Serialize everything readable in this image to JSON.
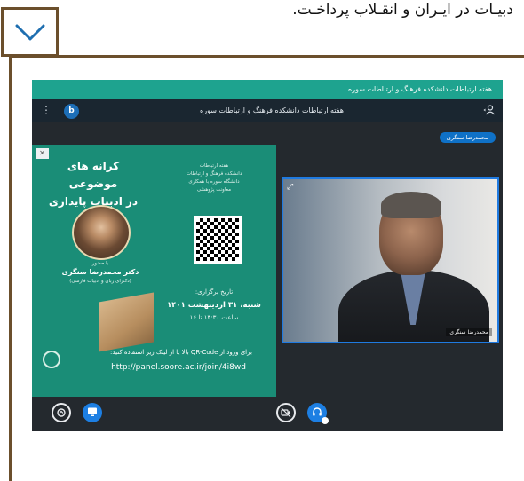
{
  "page": {
    "top_text": "دبیـات در ایـران و انقـلاب پرداخـت."
  },
  "conference": {
    "titlebar": "هفته ارتباطات دانشکده فرهنگ و ارتباطات سوره",
    "room_title": "هفته ارتباطات دانشکده فرهنگ و ارتباطات سوره",
    "app_logo": "b",
    "presenter_badge": "محمدرضا سنگری",
    "video_name": "محمدرضا سنگری"
  },
  "slide": {
    "title": "کرانه های موضوعی\nدر ادبیات پایداری",
    "guest_pre": "با حضور",
    "guest_name": "دکتر محمدرضا سنگری",
    "guest_title": "(دکترای زبان و ادبیات فارسی)",
    "org": "هفته ارتباطات\nدانشکده فرهنگ و ارتباطات\nدانشگاه سوره با همکاری\nمعاونت پژوهشی",
    "date_label": "تاریخ برگزاری:",
    "date_value": "شنبه، ۳۱ اردیبهشت ۱۴۰۱",
    "time_value": "ساعت ۱۴:۳۰ تا ۱۶",
    "join_text": "برای ورود از QR-Code بالا یا از لینک زیر استفاده کنید:",
    "join_link": "http://panel.soore.ac.ir/join/4i8wd"
  },
  "icons": {
    "menu": "more-vertical-icon",
    "user": "user-icon",
    "toggle": "chevron-down-icon",
    "close": "close-icon",
    "expand": "expand-icon"
  },
  "colors": {
    "titlebar": "#1ea38f",
    "slide_bg": "#1a8d77",
    "accent_blue": "#1d7fe3",
    "frame_brown": "#6b4f2c",
    "stage_bg": "#24292e"
  }
}
